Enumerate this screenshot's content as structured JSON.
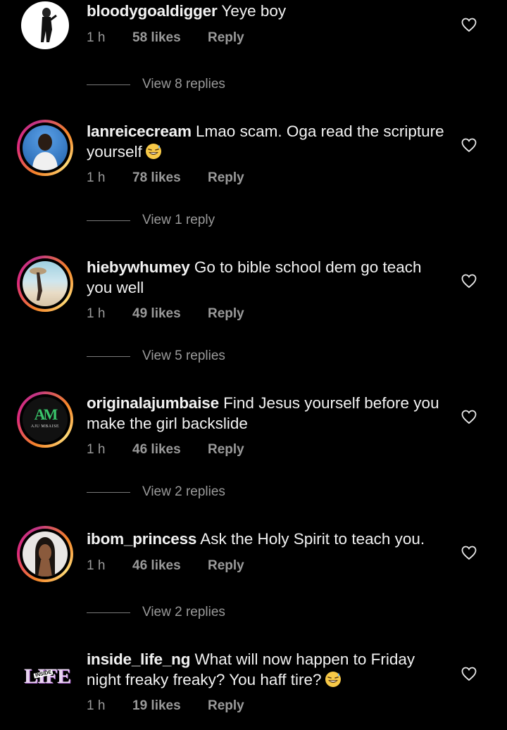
{
  "comments": [
    {
      "username": "bloodygoaldigger",
      "text": "Yeye boy",
      "time": "1 h",
      "likes": "58 likes",
      "reply_label": "Reply",
      "view_replies": "View 8 replies",
      "avatar_ring": false
    },
    {
      "username": "lanreicecream",
      "text": "Lmao scam. Oga read the scripture yourself",
      "emoji": "grinning-sweat-emoji",
      "time": "1 h",
      "likes": "78 likes",
      "reply_label": "Reply",
      "view_replies": "View 1 reply",
      "avatar_ring": true
    },
    {
      "username": "hiebywhumey",
      "text": "Go to bible school dem go teach you well",
      "time": "1 h",
      "likes": "49 likes",
      "reply_label": "Reply",
      "view_replies": "View 5 replies",
      "avatar_ring": true
    },
    {
      "username": "originalajumbaise",
      "text": "Find Jesus yourself before you make the girl backslide",
      "time": "1 h",
      "likes": "46 likes",
      "reply_label": "Reply",
      "view_replies": "View 2 replies",
      "avatar_ring": true,
      "avatar_logo": "AM",
      "avatar_logo_sub": "AJU MBAISE"
    },
    {
      "username": "ibom_princess",
      "text": "Ask the Holy Spirit to teach you.",
      "time": "1 h",
      "likes": "46 likes",
      "reply_label": "Reply",
      "view_replies": "View 2 replies",
      "avatar_ring": true
    },
    {
      "username": "inside_life_ng",
      "text": "What will now happen to Friday night freaky freaky? You haff tire?",
      "emoji": "grinning-sweat-emoji",
      "time": "1 h",
      "likes": "19 likes",
      "reply_label": "Reply",
      "avatar_ring": false,
      "avatar_logo": "LIFE",
      "avatar_logo_sub": "INSIDE"
    }
  ],
  "icons": {
    "like": "heart-outline-icon"
  },
  "colors": {
    "background": "#000000",
    "text": "#f2f2f2",
    "secondary": "#9a9a9a",
    "ring_start": "#f58529",
    "ring_end": "#dd2a7b"
  }
}
